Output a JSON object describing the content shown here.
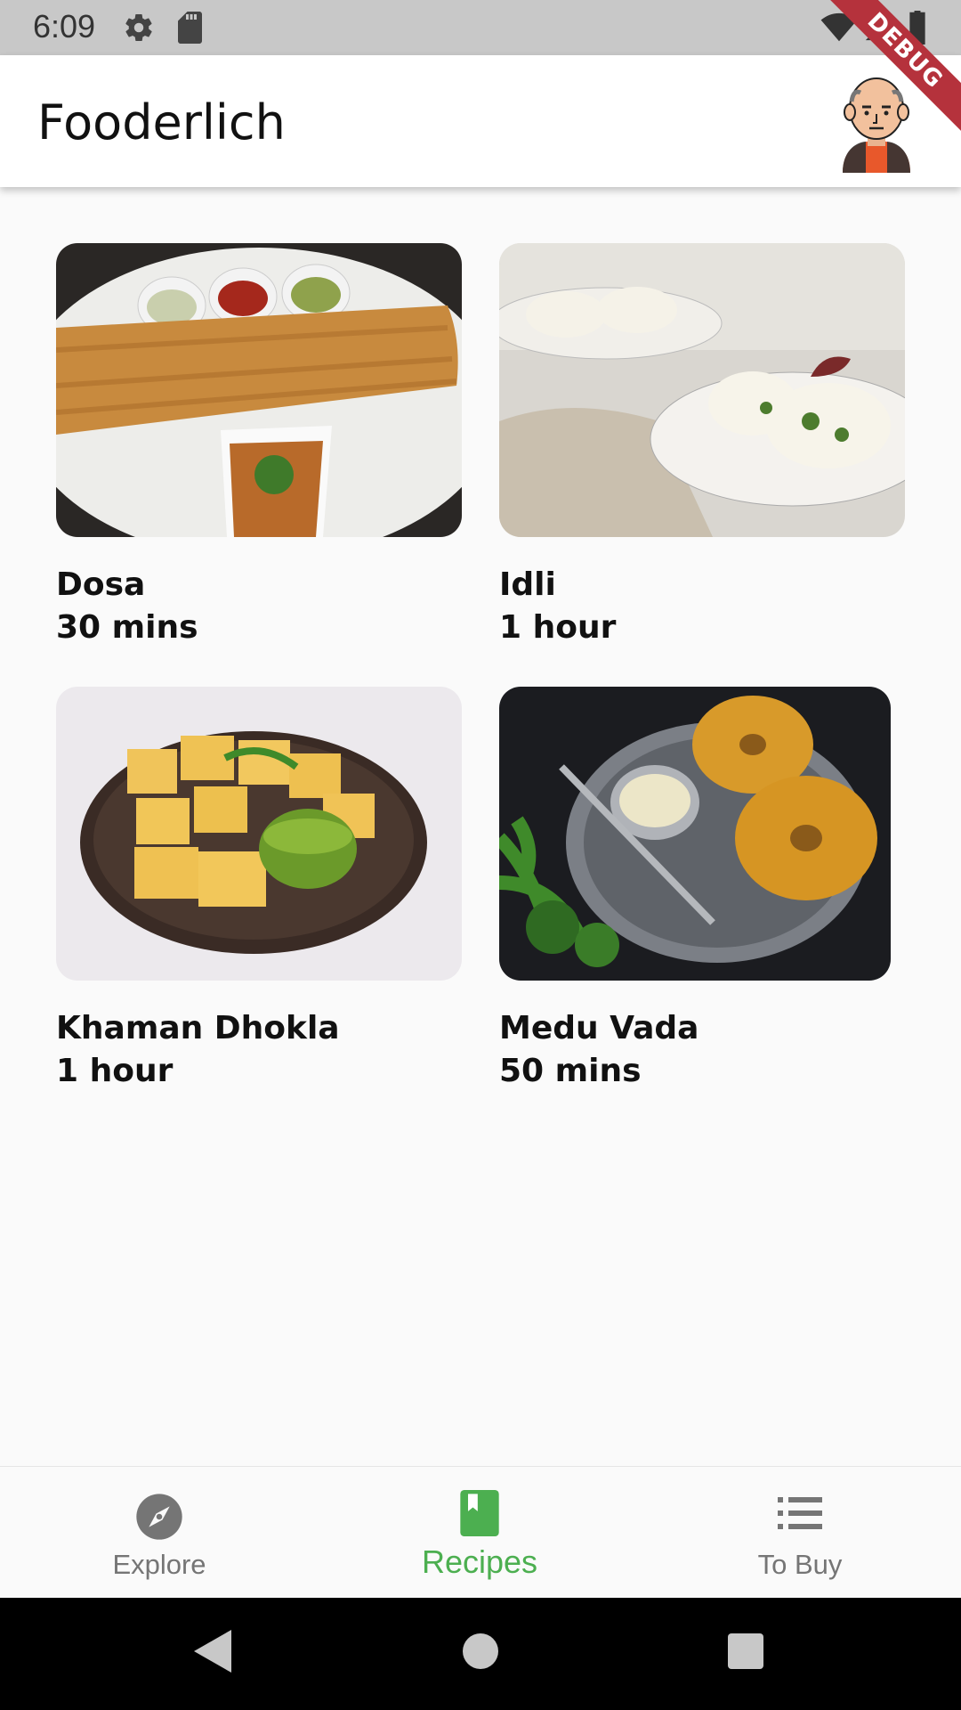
{
  "status_bar": {
    "time": "6:09",
    "icons": [
      "gear-icon",
      "sd-card-icon",
      "wifi-icon",
      "signal-icon",
      "battery-icon"
    ]
  },
  "debug_banner": "DEBUG",
  "app_bar": {
    "title": "Fooderlich",
    "avatar": "profile-avatar"
  },
  "recipes": [
    {
      "title": "Dosa",
      "duration": "30 mins",
      "image": "dosa-photo"
    },
    {
      "title": "Idli",
      "duration": "1 hour",
      "image": "idli-photo"
    },
    {
      "title": "Khaman Dhokla",
      "duration": "1 hour",
      "image": "khaman-dhokla-photo"
    },
    {
      "title": "Medu Vada",
      "duration": "50 mins",
      "image": "medu-vada-photo"
    }
  ],
  "bottom_nav": {
    "items": [
      {
        "label": "Explore",
        "icon": "compass-icon",
        "selected": false
      },
      {
        "label": "Recipes",
        "icon": "book-icon",
        "selected": true
      },
      {
        "label": "To Buy",
        "icon": "list-icon",
        "selected": false
      }
    ]
  },
  "colors": {
    "accent": "#4caf50",
    "inactive": "#757575",
    "status_bar": "#c8c8c8",
    "debug_ribbon": "#b5323c"
  },
  "android_nav": [
    "back-icon",
    "home-icon",
    "recents-icon"
  ]
}
